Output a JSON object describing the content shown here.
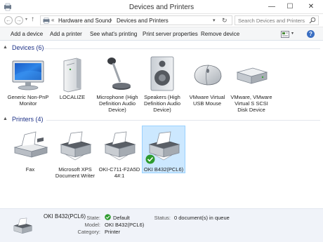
{
  "window": {
    "title": "Devices and Printers",
    "min_glyph": "—",
    "max_glyph": "☐",
    "close_glyph": "✕"
  },
  "address": {
    "back_glyph": "←",
    "forward_glyph": "→",
    "up_glyph": "↑",
    "overflow": "«",
    "crumbs": [
      "Hardware and Sound",
      "Devices and Printers"
    ],
    "separator": "›",
    "dropdown_glyph": "▾",
    "refresh_glyph": "↻",
    "search_placeholder": "Search Devices and Printers"
  },
  "toolbar": {
    "add_device": "Add a device",
    "add_printer": "Add a printer",
    "see_printing": "See what's printing",
    "print_server": "Print server properties",
    "remove_device": "Remove device",
    "view_arrow": "▾",
    "help": "?"
  },
  "groups": {
    "devices": {
      "label": "Devices (6)",
      "chevron": "▲"
    },
    "printers": {
      "label": "Printers (4)",
      "chevron": "▲"
    }
  },
  "devices": [
    {
      "label": "Generic Non-PnP Monitor",
      "icon": "monitor-icon"
    },
    {
      "label": "LOCALIZE",
      "icon": "computer-tower-icon"
    },
    {
      "label": "Microphone (High Definition Audio Device)",
      "icon": "microphone-icon"
    },
    {
      "label": "Speakers (High Definition Audio Device)",
      "icon": "speaker-icon"
    },
    {
      "label": "VMware Virtual USB Mouse",
      "icon": "mouse-icon"
    },
    {
      "label": "VMware, VMware Virtual S SCSI Disk Device",
      "icon": "disk-drive-icon"
    }
  ],
  "printers": [
    {
      "label": "Fax",
      "icon": "fax-icon"
    },
    {
      "label": "Microsoft XPS Document Writer",
      "icon": "printer-icon"
    },
    {
      "label": "OKI-C711-F2A5D 4#:1",
      "icon": "printer-icon"
    },
    {
      "label": "OKI B432(PCL6)",
      "icon": "printer-default-icon",
      "selected": true
    }
  ],
  "details": {
    "name": "OKI B432(PCL6)",
    "state_label": "State:",
    "state_value": "Default",
    "model_label": "Model:",
    "model_value": "OKI B432(PCL6)",
    "category_label": "Category:",
    "category_value": "Printer",
    "status_label": "Status:",
    "status_value": "0 document(s) in queue"
  },
  "colors": {
    "selection_bg": "#cce8ff",
    "group_header": "#1e3287",
    "default_check": "#2e9b2e"
  }
}
